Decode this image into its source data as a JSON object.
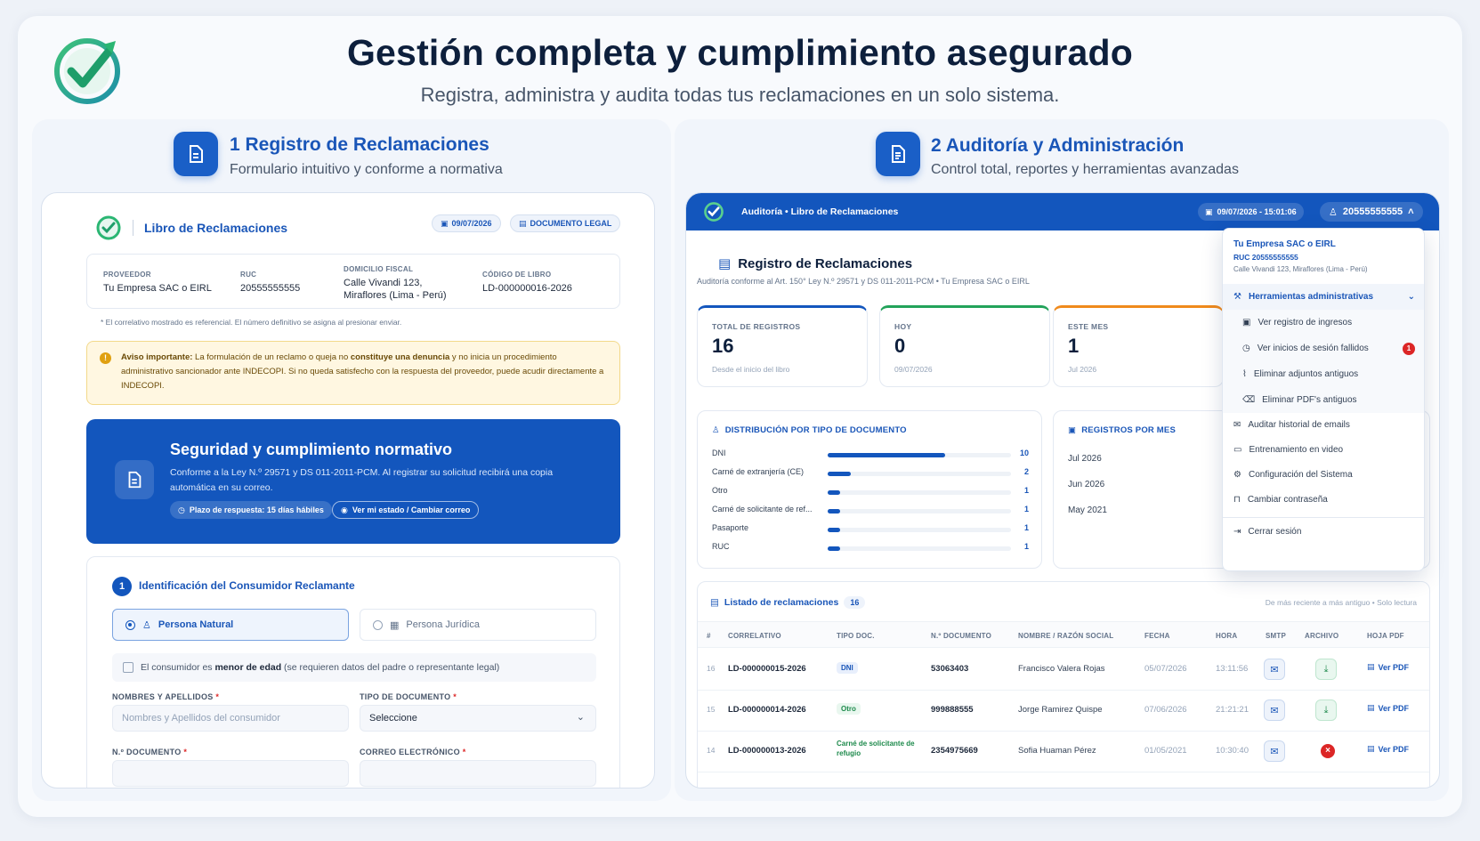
{
  "header": {
    "title": "Gestión completa y cumplimiento asegurado",
    "subtitle": "Registra, administra y audita todas tus reclamaciones en un solo sistema."
  },
  "left_section": {
    "title": "1 Registro de Reclamaciones",
    "subtitle": "Formulario intuitivo y conforme a normativa"
  },
  "right_section": {
    "title": "2 Auditoría y Administración",
    "subtitle": "Control total, reportes y herramientas avanzadas"
  },
  "libro": {
    "title": "Libro de Reclamaciones",
    "date_chip": "09/07/2026",
    "legal_chip": "DOCUMENTO LEGAL",
    "provider": {
      "proveedor_label": "PROVEEDOR",
      "proveedor": "Tu Empresa SAC o EIRL",
      "ruc_label": "RUC",
      "ruc": "20555555555",
      "domicilio_label": "DOMICILIO FISCAL",
      "domicilio_1": "Calle Vivandi 123,",
      "domicilio_2": "Miraflores (Lima - Perú)",
      "codigo_label": "CÓDIGO DE LIBRO",
      "codigo": "LD-000000016-2026"
    },
    "note": "* El correlativo mostrado es referencial. El número definitivo se asigna al presionar enviar.",
    "warning": {
      "lead": "Aviso importante:",
      "part1": " La formulación de un reclamo o queja no ",
      "bold": "constituye una denuncia",
      "part2": " y no inicia un procedimiento administrativo sancionador ante INDECOPI. Si no queda satisfecho con la respuesta del proveedor, puede acudir directamente a INDECOPI."
    },
    "security": {
      "title": "Seguridad y cumplimiento normativo",
      "text": "Conforme a la Ley N.º 29571 y DS 011-2011-PCM. Al registrar su solicitud recibirá una copia automática en su correo.",
      "pill1": "Plazo de respuesta: 15 días hábiles",
      "pill2": "Ver mi estado / Cambiar correo"
    },
    "form": {
      "step": "1",
      "title": "Identificación del Consumidor Reclamante",
      "radio_natural": "Persona Natural",
      "radio_juridica": "Persona Jurídica",
      "minor_pre": "El consumidor es ",
      "minor_bold": "menor de edad",
      "minor_post": " (se requieren datos del padre o representante legal)",
      "nombres_label": "NOMBRES Y APELLIDOS",
      "nombres_placeholder": "Nombres y Apellidos del consumidor",
      "tipo_label": "TIPO DE DOCUMENTO",
      "tipo_value": "Seleccione",
      "ndoc_label": "N.º DOCUMENTO",
      "correo_label": "CORREO ELECTRÓNICO",
      "required": "*"
    }
  },
  "audit": {
    "topbar_title": "Auditoría • Libro de Reclamaciones",
    "topbar_date": "09/07/2026 - 15:01:06",
    "user": "20555555555",
    "reg_title": "Registro de Reclamaciones",
    "reg_sub": "Auditoría conforme al Art. 150° Ley N.º 29571 y DS 011-2011-PCM • Tu Empresa SAC o EIRL",
    "stats": [
      {
        "label": "TOTAL DE REGISTROS",
        "value": "16",
        "sub": "Desde el inicio del libro",
        "color": "#1356bd"
      },
      {
        "label": "HOY",
        "value": "0",
        "sub": "09/07/2026",
        "color": "#22a35a"
      },
      {
        "label": "ESTE MES",
        "value": "1",
        "sub": "Jul 2026",
        "color": "#f08a1c"
      }
    ],
    "dist_title": "DISTRIBUCIÓN POR TIPO DE DOCUMENTO",
    "dist": [
      {
        "label": "DNI",
        "value": 10
      },
      {
        "label": "Carné de extranjería (CE)",
        "value": 2
      },
      {
        "label": "Otro",
        "value": 1
      },
      {
        "label": "Carné de solicitante de ref...",
        "value": 1
      },
      {
        "label": "Pasaporte",
        "value": 1
      },
      {
        "label": "RUC",
        "value": 1
      }
    ],
    "months_title": "REGISTROS POR MES",
    "months": [
      "Jul 2026",
      "Jun 2026",
      "May 2021"
    ],
    "list_title": "Listado de reclamaciones",
    "list_count": "16",
    "list_order": "De más reciente a más antiguo • Solo lectura",
    "columns": [
      "#",
      "CORRELATIVO",
      "TIPO DOC.",
      "N.º DOCUMENTO",
      "NOMBRE / RAZÓN SOCIAL",
      "FECHA",
      "HORA",
      "SMTP",
      "ARCHIVO",
      "HOJA PDF"
    ],
    "rows": [
      {
        "n": "16",
        "corr": "LD-000000015-2026",
        "tipo": "DNI",
        "doc": "53063403",
        "nombre": "Francisco Valera Rojas",
        "fecha": "05/07/2026",
        "hora": "13:11:56",
        "archivo": "download",
        "pdf": "Ver PDF"
      },
      {
        "n": "15",
        "corr": "LD-000000014-2026",
        "tipo": "Otro",
        "doc": "999888555",
        "nombre": "Jorge Ramirez Quispe",
        "fecha": "07/06/2026",
        "hora": "21:21:21",
        "archivo": "download",
        "pdf": "Ver PDF"
      },
      {
        "n": "14",
        "corr": "LD-000000013-2026",
        "tipo": "Carné de solicitante de refugio",
        "doc": "2354975669",
        "nombre": "Sofia Huaman Pérez",
        "fecha": "01/05/2021",
        "hora": "10:30:40",
        "archivo": "error",
        "pdf": "Ver PDF"
      }
    ],
    "menu": {
      "company": "Tu Empresa SAC o EIRL",
      "ruc": "RUC 20555555555",
      "address": "Calle Vivandi 123, Miraflores (Lima - Perú)",
      "tools": "Herramientas administrativas",
      "items": [
        "Ver registro de ingresos",
        "Ver inicios de sesión fallidos",
        "Eliminar adjuntos antiguos",
        "Eliminar PDF's antiguos"
      ],
      "failed_count": "1",
      "more": [
        "Auditar historial de emails",
        "Entrenamiento en video",
        "Configuración del Sistema",
        "Cambiar contraseña"
      ],
      "logout": "Cerrar sesión"
    }
  },
  "colors": {
    "primary": "#1356bd",
    "accent_green": "#22a35a",
    "accent_orange": "#f08a1c",
    "danger": "#dc2626"
  }
}
